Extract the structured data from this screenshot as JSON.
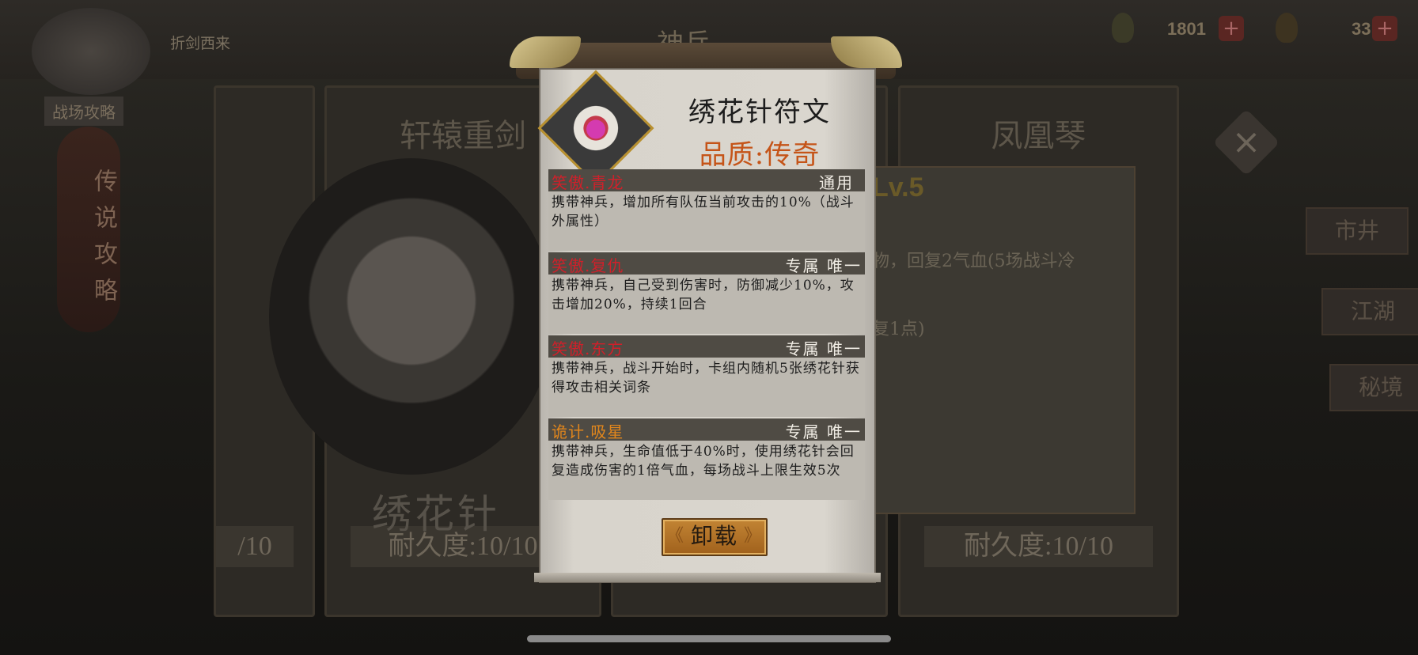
{
  "header": {
    "title": "神兵",
    "nav_left": "折剑西来",
    "currency_1": "1801",
    "currency_2": "33",
    "left_label": "战场攻略",
    "side_ornament": "传说攻略"
  },
  "background": {
    "cards": [
      {
        "name": "",
        "durability": "/10"
      },
      {
        "name": "轩辕重剑",
        "durability": "耐久度:10/10"
      },
      {
        "name": "",
        "durability": ""
      },
      {
        "name": "凤凰琴",
        "durability": "耐久度:10/10"
      }
    ],
    "weapon_name": "绣花针",
    "right_panel": {
      "level": "Lv.5",
      "line1": "物，回复2气血(5场战斗冷",
      "line2": "复1点)"
    },
    "side_buttons": [
      "市井",
      "江湖",
      "秘境"
    ]
  },
  "popup": {
    "item_name": "绣花针符文",
    "quality": "品质:传奇",
    "runes": [
      {
        "title": "笑傲.青龙",
        "tag": "通用",
        "desc": "携带神兵，增加所有队伍当前攻击的10%（战斗外属性）"
      },
      {
        "title": "笑傲.复仇",
        "tag": "专属 唯一",
        "desc": "携带神兵，自己受到伤害时，防御减少10%，攻击增加20%，持续1回合"
      },
      {
        "title": "笑傲.东方",
        "tag": "专属 唯一",
        "desc": "携带神兵，战斗开始时，卡组内随机5张绣花针获得攻击相关词条"
      },
      {
        "title": "诡计.吸星",
        "tag": "专属 唯一",
        "desc": "携带神兵，生命值低于40%时，使用绣花针会回复造成伤害的1倍气血，每场战斗上限生效5次"
      }
    ],
    "unload_label": "卸载"
  },
  "colors": {
    "quality_legendary": "#c55418",
    "rune_title_red": "#d0202a",
    "rune_title_gold": "#e1861c",
    "button_gold": "#c28434"
  }
}
